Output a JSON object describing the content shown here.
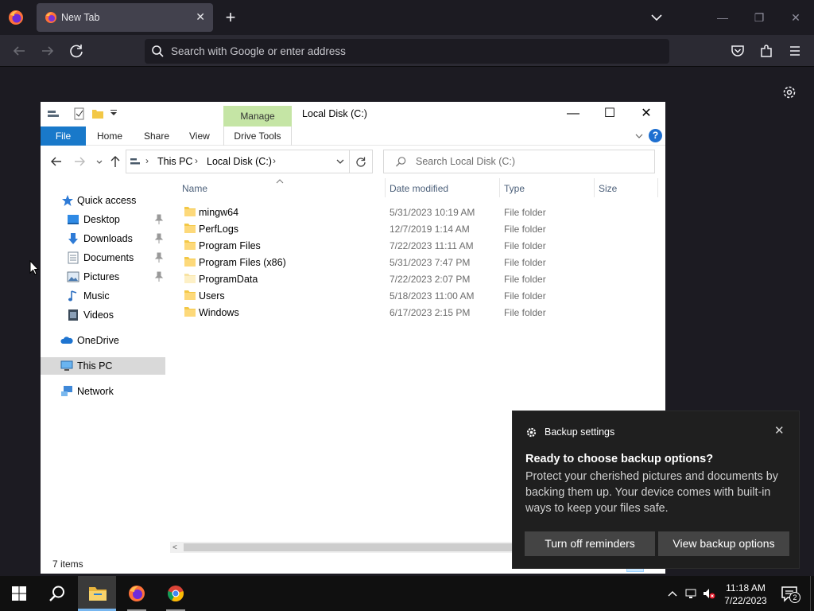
{
  "browser": {
    "tab": {
      "title": "New Tab",
      "close_glyph": "✕"
    },
    "new_tab_glyph": "+",
    "urlbar": {
      "placeholder": "Search with Google or enter address"
    },
    "window_controls": {
      "minimize": "—",
      "restore": "❐",
      "close": "✕"
    }
  },
  "explorer": {
    "title": "Local Disk (C:)",
    "manage_label": "Manage",
    "ribbon_tabs": {
      "file": "File",
      "home": "Home",
      "share": "Share",
      "view": "View",
      "drive_tools": "Drive Tools"
    },
    "help_glyph": "?",
    "window_controls": {
      "minimize": "—",
      "maximize": "☐",
      "close": "✕"
    },
    "breadcrumb": {
      "root": "This PC",
      "current": "Local Disk (C:)",
      "sep": "›"
    },
    "search_placeholder": "Search Local Disk (C:)",
    "nav": {
      "quick_access": "Quick access",
      "desktop": "Desktop",
      "downloads": "Downloads",
      "documents": "Documents",
      "pictures": "Pictures",
      "music": "Music",
      "videos": "Videos",
      "onedrive": "OneDrive",
      "this_pc": "This PC",
      "network": "Network"
    },
    "columns": {
      "name": "Name",
      "date": "Date modified",
      "type": "Type",
      "size": "Size"
    },
    "files": [
      {
        "name": "mingw64",
        "date": "5/31/2023 10:19 AM",
        "type": "File folder"
      },
      {
        "name": "PerfLogs",
        "date": "12/7/2019 1:14 AM",
        "type": "File folder"
      },
      {
        "name": "Program Files",
        "date": "7/22/2023 11:11 AM",
        "type": "File folder"
      },
      {
        "name": "Program Files (x86)",
        "date": "5/31/2023 7:47 PM",
        "type": "File folder"
      },
      {
        "name": "ProgramData",
        "date": "7/22/2023 2:07 PM",
        "type": "File folder"
      },
      {
        "name": "Users",
        "date": "5/18/2023 11:00 AM",
        "type": "File folder"
      },
      {
        "name": "Windows",
        "date": "6/17/2023 2:15 PM",
        "type": "File folder"
      }
    ],
    "status": "7 items",
    "scroll_left_glyph": "<"
  },
  "toast": {
    "app_name": "Backup settings",
    "close_glyph": "✕",
    "title": "Ready to choose backup options?",
    "body": "Protect your cherished pictures and documents by backing them up. Your device comes with built-in ways to keep your files safe.",
    "buttons": {
      "turn_off": "Turn off reminders",
      "view": "View backup options"
    }
  },
  "taskbar": {
    "time": "11:18 AM",
    "date": "7/22/2023",
    "notification_count": "2"
  },
  "colors": {
    "firefox_bg": "#1c1b22",
    "accent_blue": "#1979ca",
    "manage_green": "#c5e5a5",
    "folder_yellow": "#f3c846",
    "toast_bg": "#1f1f1f"
  }
}
